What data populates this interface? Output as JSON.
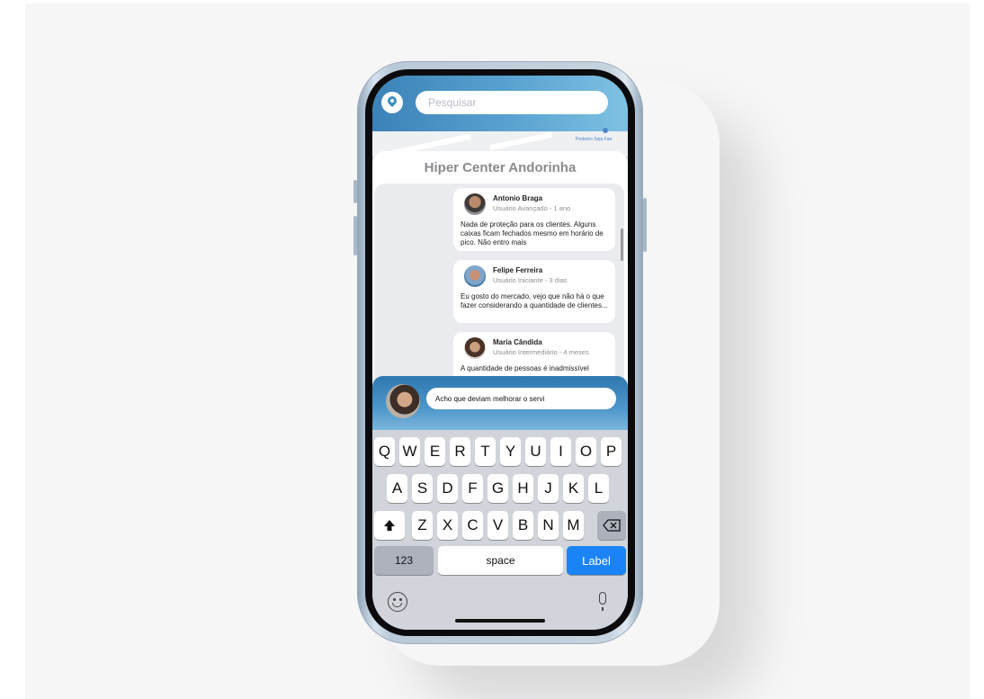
{
  "search": {
    "placeholder": "Pesquisar"
  },
  "map": {
    "label": "Pedreiro Seja Fan"
  },
  "place": {
    "title": "Hiper Center Andorinha"
  },
  "reviews": [
    {
      "name": "Antonio Braga",
      "meta": "Usuário Avançado - 1 ano",
      "text": "Nada de proteção para os clientes. Alguns caixas ficam fechados mesmo em horário de pico. Não entro mais"
    },
    {
      "name": "Felipe Ferreira",
      "meta": "Usuário Iniciante - 3 dias",
      "text": "Eu gosto do mercado, vejo que não há o que fazer considerando a quantidade de clientes..."
    },
    {
      "name": "Maria Cândida",
      "meta": "Usuário Intermediário - 4 meses",
      "text": "A quantidade de pessoas é inadmissível"
    }
  ],
  "composer": {
    "value": "Acho que deviam melhorar o servi"
  },
  "keyboard": {
    "row1": [
      "Q",
      "W",
      "E",
      "R",
      "T",
      "Y",
      "U",
      "I",
      "O",
      "P"
    ],
    "row2": [
      "A",
      "S",
      "D",
      "F",
      "G",
      "H",
      "J",
      "K",
      "L"
    ],
    "row3": [
      "Z",
      "X",
      "C",
      "V",
      "B",
      "N",
      "M"
    ],
    "numbers_label": "123",
    "space_label": "space",
    "action_label": "Label",
    "shift_icon": "shift-icon",
    "delete_icon": "delete-icon"
  },
  "colors": {
    "accent": "#1a84f6",
    "header": "#3b82b7"
  }
}
